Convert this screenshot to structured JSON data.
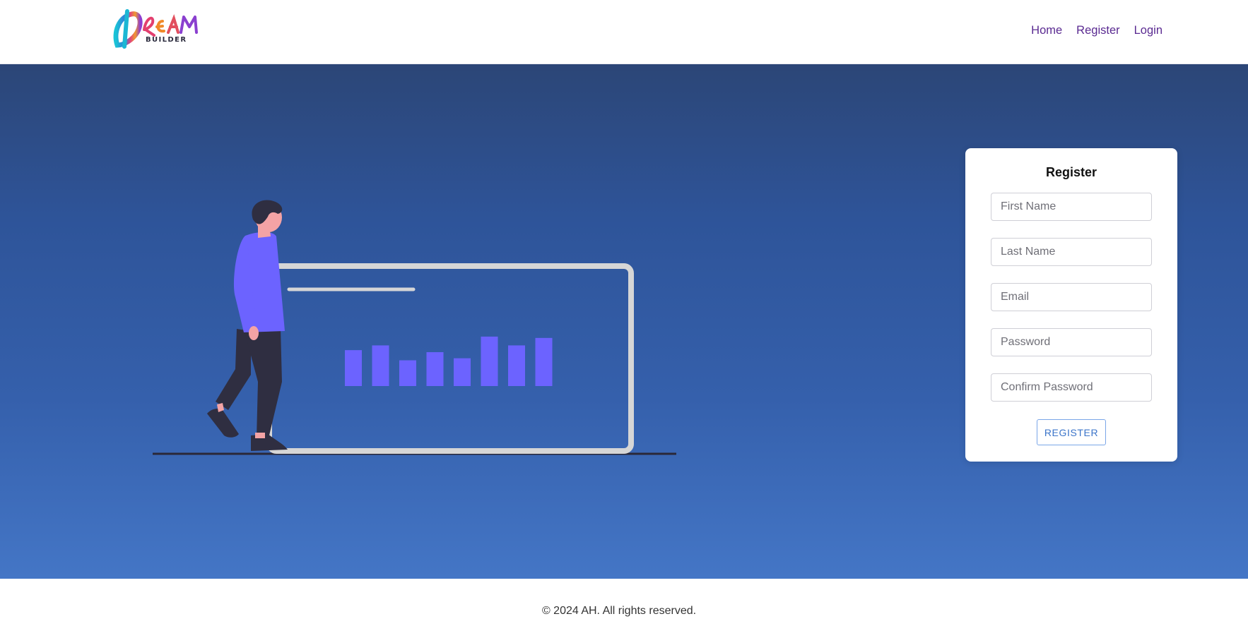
{
  "header": {
    "logo": {
      "script_text": "DREAM",
      "sub_text": "BUILDER"
    },
    "nav": [
      {
        "label": "Home"
      },
      {
        "label": "Register"
      },
      {
        "label": "Login"
      }
    ],
    "link_color": "#5a2a91"
  },
  "hero": {
    "background_top": "#2c4677",
    "background_bottom": "#4476c6",
    "illustration": {
      "icon": "person-with-bar-chart-illustration",
      "bar_color": "#6c63ff",
      "bar_levels": [
        0.53,
        0.6,
        0.38,
        0.5,
        0.41,
        0.73,
        0.6,
        0.71
      ]
    }
  },
  "register_form": {
    "title": "Register",
    "fields": [
      {
        "placeholder": "First Name",
        "value": ""
      },
      {
        "placeholder": "Last Name",
        "value": ""
      },
      {
        "placeholder": "Email",
        "value": ""
      },
      {
        "placeholder": "Password",
        "value": ""
      },
      {
        "placeholder": "Confirm Password",
        "value": ""
      }
    ],
    "submit_label": "REGISTER",
    "accent_color": "#3b74c9"
  },
  "footer": {
    "text": "© 2024 AH. All rights reserved."
  }
}
